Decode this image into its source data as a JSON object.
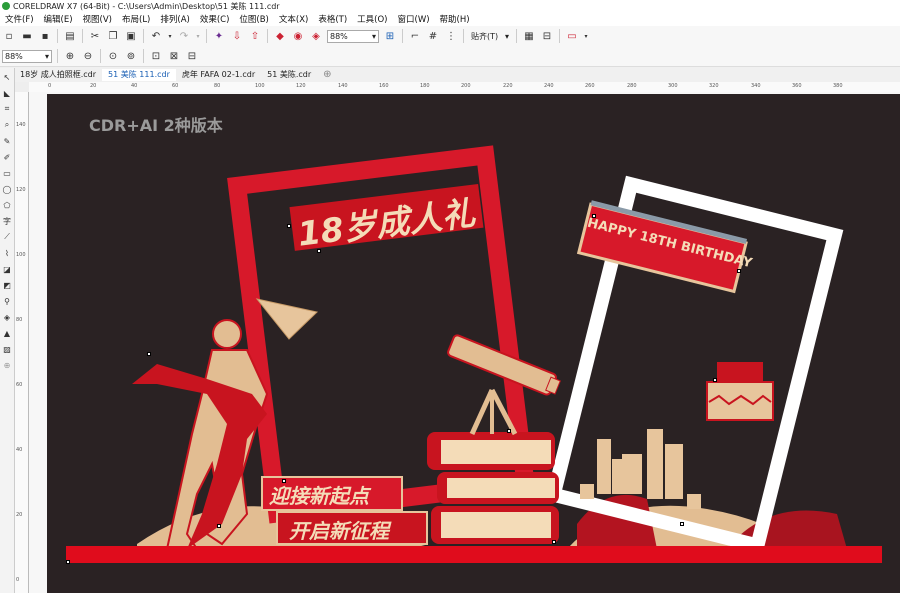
{
  "window": {
    "title": "CORELDRAW X7 (64-Bit) - C:\\Users\\Admin\\Desktop\\51 美陈 111.cdr"
  },
  "menu": [
    "文件(F)",
    "编辑(E)",
    "视图(V)",
    "布局(L)",
    "排列(A)",
    "效果(C)",
    "位图(B)",
    "文本(X)",
    "表格(T)",
    "工具(O)",
    "窗口(W)",
    "帮助(H)"
  ],
  "toolbar": {
    "zoom": "88%",
    "snap_label": "贴齐(T)"
  },
  "propertybar": {
    "zoom": "88%"
  },
  "tabs": [
    "18岁 成人拍照框.cdr",
    "51 美陈 111.cdr",
    "虎年 FAFA 02-1.cdr",
    "51 美陈.cdr"
  ],
  "ruler_h": [
    "0",
    "20",
    "40",
    "60",
    "80",
    "100",
    "120",
    "140",
    "160",
    "180",
    "200",
    "220",
    "240",
    "260",
    "280",
    "300",
    "320",
    "340",
    "360",
    "380"
  ],
  "ruler_v": [
    "140",
    "120",
    "100",
    "80",
    "60",
    "40",
    "20",
    "0"
  ],
  "artwork": {
    "version_text": "CDR+AI 2种版本",
    "title_main": "18岁成人礼",
    "banner_text": "HAPPY 18TH BIRTHDAY",
    "slogan1": "迎接新起点",
    "slogan2": "开启新征程"
  },
  "colors": {
    "red": "#d7192a",
    "dark_red": "#a8141f",
    "gold": "#e7c59c",
    "gold_dark": "#c79a66",
    "page": "#2a2223"
  }
}
